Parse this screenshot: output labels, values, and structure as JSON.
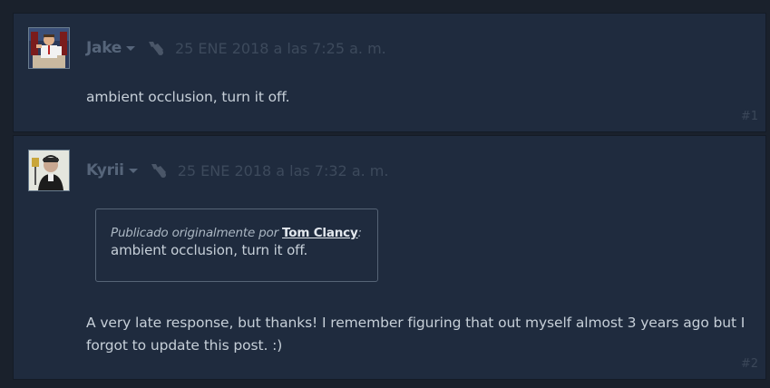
{
  "posts": [
    {
      "author": "Jake",
      "timestamp": "25 ENE 2018 a las 7:25 a. m.",
      "text": "ambient occlusion, turn it off.",
      "number": "#1"
    },
    {
      "author": "Kyrii",
      "timestamp": "25 ENE 2018 a las 7:32 a. m.",
      "quote": {
        "prefix": "Publicado originalmente por",
        "author": "Tom Clancy",
        "suffix": ":",
        "text": "ambient occlusion, turn it off."
      },
      "text": "A very late response, but thanks! I remember figuring that out myself almost 3 years ago but I forgot to update this post. :)",
      "number": "#2"
    }
  ],
  "colors": {
    "post_bg": "#1f2b3e",
    "page_bg": "#1a212c",
    "author": "#56657a",
    "timestamp": "#3d4a5c",
    "text": "#c6cfd8",
    "quote_border": "#566476"
  },
  "icons": {
    "caret": "chevron-down-icon",
    "award": "award-icon"
  }
}
